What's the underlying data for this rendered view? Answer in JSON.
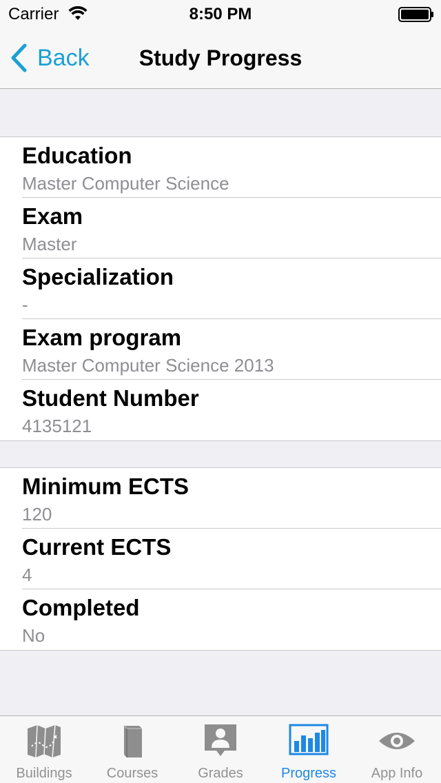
{
  "status_bar": {
    "carrier": "Carrier",
    "time": "8:50 PM"
  },
  "nav": {
    "back_label": "Back",
    "title": "Study Progress"
  },
  "groups": [
    {
      "rows": [
        {
          "title": "Education",
          "value": "Master Computer Science"
        },
        {
          "title": "Exam",
          "value": "Master"
        },
        {
          "title": "Specialization",
          "value": "-"
        },
        {
          "title": "Exam program",
          "value": "Master Computer Science 2013"
        },
        {
          "title": "Student Number",
          "value": "4135121"
        }
      ]
    },
    {
      "rows": [
        {
          "title": "Minimum ECTS",
          "value": "120"
        },
        {
          "title": "Current ECTS",
          "value": "4"
        },
        {
          "title": "Completed",
          "value": "No"
        }
      ]
    }
  ],
  "tab_bar": {
    "tabs": [
      {
        "label": "Buildings",
        "icon": "map-icon"
      },
      {
        "label": "Courses",
        "icon": "book-icon"
      },
      {
        "label": "Grades",
        "icon": "person-icon"
      },
      {
        "label": "Progress",
        "icon": "bar-chart-icon",
        "active": true
      },
      {
        "label": "App Info",
        "icon": "eye-icon"
      }
    ]
  },
  "colors": {
    "accent": "#1aa0d6",
    "active_tab": "#1e88e5",
    "inactive_tab": "#929292",
    "subtitle": "#8e8e93",
    "background": "#efeff4"
  }
}
